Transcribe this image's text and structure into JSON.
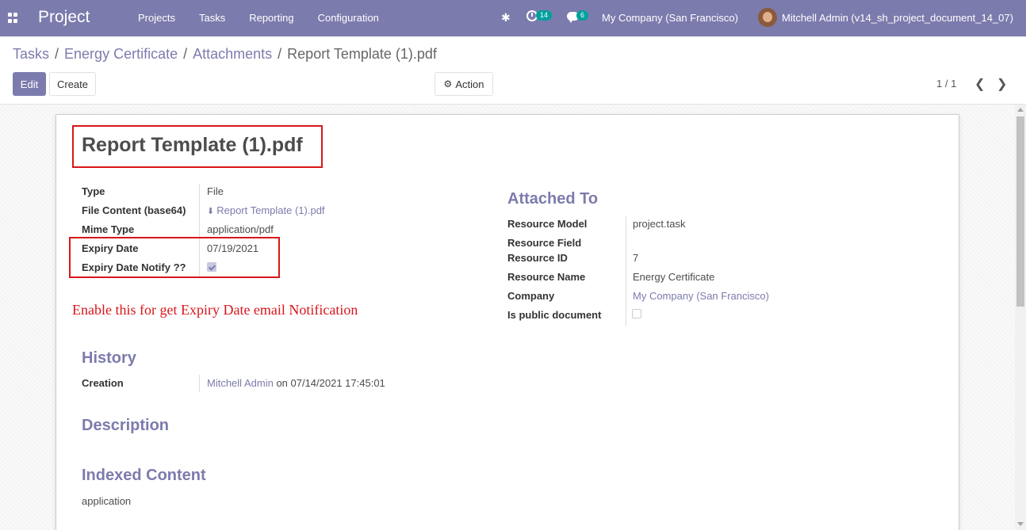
{
  "navbar": {
    "brand": "Project",
    "menu": [
      "Projects",
      "Tasks",
      "Reporting",
      "Configuration"
    ],
    "activity_count": "14",
    "message_count": "6",
    "company": "My Company (San Francisco)",
    "user": "Mitchell Admin (v14_sh_project_document_14_07)"
  },
  "breadcrumb": {
    "items": [
      "Tasks",
      "Energy Certificate",
      "Attachments"
    ],
    "current": "Report Template (1).pdf"
  },
  "buttons": {
    "edit": "Edit",
    "create": "Create",
    "action": "Action"
  },
  "pager": "1 / 1",
  "form": {
    "title": "Report Template (1).pdf",
    "left_fields": {
      "type_label": "Type",
      "type_value": "File",
      "content_label": "File Content (base64)",
      "content_value": "Report Template (1).pdf",
      "mime_label": "Mime Type",
      "mime_value": "application/pdf",
      "expiry_label": "Expiry Date",
      "expiry_value": "07/19/2021",
      "notify_label": "Expiry Date Notify ??",
      "notify_checked": true
    },
    "annotation": "Enable this for get Expiry Date email Notification",
    "attached_to": {
      "title": "Attached To",
      "model_label": "Resource Model",
      "model_value": "project.task",
      "field_label": "Resource Field",
      "field_value": "",
      "id_label": "Resource ID",
      "id_value": "7",
      "name_label": "Resource Name",
      "name_value": "Energy Certificate",
      "company_label": "Company",
      "company_value": "My Company (San Francisco)",
      "public_label": "Is public document",
      "public_checked": false
    },
    "history": {
      "title": "History",
      "creation_label": "Creation",
      "creation_user": "Mitchell Admin",
      "creation_rest": "on 07/14/2021 17:45:01"
    },
    "description_title": "Description",
    "indexed": {
      "title": "Indexed Content",
      "value": "application"
    }
  },
  "colors": {
    "brand": "#7c7bad",
    "annotation_red": "#d9161b",
    "badge": "#00a09d"
  }
}
